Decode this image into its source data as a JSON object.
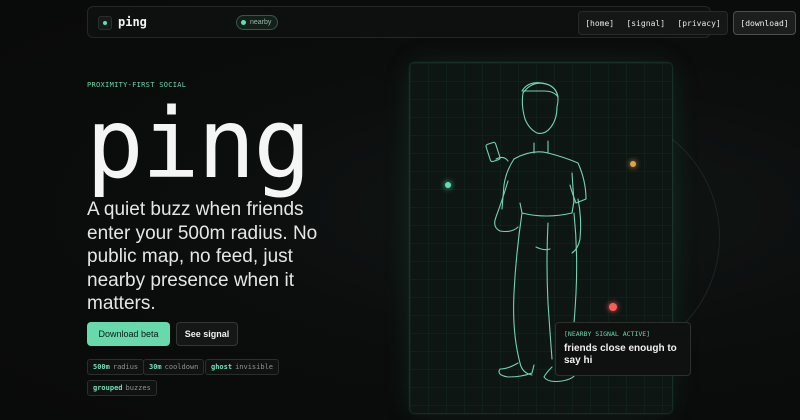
{
  "nav": {
    "brand": "ping",
    "badge": "nearby",
    "links": [
      "[home]",
      "[signal]",
      "[privacy]"
    ],
    "download": "[download]"
  },
  "hero": {
    "eyebrow": "PROXIMITY-FIRST SOCIAL",
    "title": "ping",
    "description": "A quiet buzz when friends enter your 500m radius. No public map, no feed, just nearby presence when it matters.",
    "primary_cta": "Download beta",
    "secondary_cta": "See signal",
    "chips": [
      {
        "value": "500m",
        "label": "radius"
      },
      {
        "value": "30m",
        "label": "cooldown"
      },
      {
        "value": "ghost",
        "label": "invisible"
      },
      {
        "value": "grouped",
        "label": "buzzes"
      }
    ]
  },
  "signal_card": {
    "label": "[NEARBY SIGNAL ACTIVE]",
    "text": "friends close enough to say hi"
  },
  "colors": {
    "accent": "#67d9ac",
    "dot_green": "#5fe0b0",
    "dot_amber": "#e0a24a",
    "dot_red": "#ff5a5a",
    "background": "#0b0c0c"
  },
  "icons": [
    "logo-mark-icon",
    "person-illustration"
  ]
}
